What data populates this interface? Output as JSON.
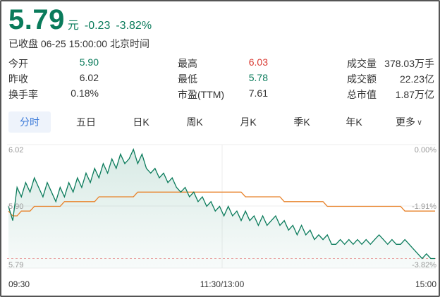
{
  "header": {
    "price": "5.79",
    "unit": "元",
    "change": "-0.23",
    "change_pct": "-3.82%",
    "status_time": "已收盘 06-25 15:00:00 北京时间"
  },
  "stats": [
    [
      {
        "label": "今开",
        "value": "5.90",
        "color": "green"
      },
      {
        "label": "最高",
        "value": "6.03",
        "color": "red"
      },
      {
        "label": "成交量",
        "value": "378.03万手",
        "color": ""
      }
    ],
    [
      {
        "label": "昨收",
        "value": "6.02",
        "color": ""
      },
      {
        "label": "最低",
        "value": "5.78",
        "color": "green"
      },
      {
        "label": "成交额",
        "value": "22.23亿",
        "color": ""
      }
    ],
    [
      {
        "label": "换手率",
        "value": "0.18%",
        "color": ""
      },
      {
        "label": "市盈(TTM)",
        "value": "7.61",
        "color": ""
      },
      {
        "label": "总市值",
        "value": "1.87万亿",
        "color": ""
      }
    ]
  ],
  "tabs": [
    "分时",
    "五日",
    "日K",
    "周K",
    "月K",
    "季K",
    "年K",
    "更多"
  ],
  "active_tab": "分时",
  "colors": {
    "up": "#d93a32",
    "down": "#0a7b5b",
    "avg_line": "#e8822a",
    "accent": "#3d7bd9"
  },
  "chart_data": {
    "type": "line",
    "y_left_labels": [
      "6.02",
      "5.90",
      "5.79"
    ],
    "y_right_labels": [
      "0.00%",
      "-1.91%",
      "-3.82%"
    ],
    "x_labels": [
      "09:30",
      "11:30/13:00",
      "15:00"
    ],
    "ylim": [
      5.77,
      6.03
    ],
    "prev_close": 6.02,
    "grid": true,
    "series": [
      {
        "values": [
          5.9,
          5.87,
          5.94,
          5.92,
          5.95,
          5.93,
          5.96,
          5.94,
          5.92,
          5.95,
          5.93,
          5.91,
          5.94,
          5.92,
          5.95,
          5.93,
          5.96,
          5.94,
          5.97,
          5.95,
          5.98,
          5.96,
          5.99,
          5.97,
          6.0,
          5.98,
          6.01,
          5.99,
          6.0,
          6.02,
          5.99,
          6.01,
          5.98,
          5.97,
          5.98,
          5.96,
          5.97,
          5.95,
          5.96,
          5.94,
          5.93,
          5.94,
          5.92,
          5.93,
          5.91,
          5.92,
          5.9,
          5.91,
          5.89,
          5.9,
          5.88,
          5.9,
          5.88,
          5.89,
          5.87,
          5.89,
          5.87,
          5.88,
          5.86,
          5.88,
          5.86,
          5.87,
          5.88,
          5.86,
          5.87,
          5.85,
          5.86,
          5.84,
          5.86,
          5.84,
          5.85,
          5.83,
          5.84,
          5.83,
          5.84,
          5.82,
          5.82,
          5.83,
          5.82,
          5.83,
          5.82,
          5.83,
          5.82,
          5.83,
          5.82,
          5.83,
          5.84,
          5.83,
          5.82,
          5.83,
          5.82,
          5.82,
          5.83,
          5.82,
          5.81,
          5.8,
          5.79,
          5.8,
          5.79,
          5.79
        ]
      },
      {
        "values": [
          5.89,
          5.88,
          5.88,
          5.89,
          5.89,
          5.89,
          5.9,
          5.9,
          5.9,
          5.9,
          5.9,
          5.9,
          5.9,
          5.91,
          5.91,
          5.91,
          5.91,
          5.91,
          5.91,
          5.91,
          5.91,
          5.92,
          5.92,
          5.92,
          5.92,
          5.92,
          5.92,
          5.92,
          5.92,
          5.92,
          5.93,
          5.93,
          5.93,
          5.93,
          5.93,
          5.93,
          5.93,
          5.93,
          5.93,
          5.93,
          5.93,
          5.93,
          5.93,
          5.93,
          5.93,
          5.93,
          5.93,
          5.93,
          5.93,
          5.93,
          5.93,
          5.93,
          5.93,
          5.93,
          5.93,
          5.92,
          5.92,
          5.92,
          5.92,
          5.92,
          5.92,
          5.92,
          5.92,
          5.92,
          5.91,
          5.91,
          5.91,
          5.91,
          5.91,
          5.91,
          5.91,
          5.91,
          5.91,
          5.91,
          5.9,
          5.9,
          5.9,
          5.9,
          5.9,
          5.9,
          5.9,
          5.9,
          5.9,
          5.9,
          5.9,
          5.9,
          5.9,
          5.9,
          5.9,
          5.9,
          5.9,
          5.9,
          5.89,
          5.89,
          5.89,
          5.89,
          5.89,
          5.89,
          5.89,
          5.89
        ]
      }
    ]
  }
}
